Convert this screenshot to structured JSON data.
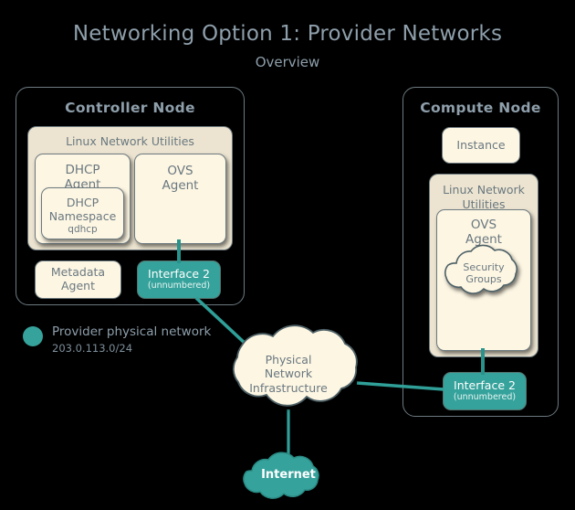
{
  "header": {
    "title": "Networking Option 1: Provider Networks",
    "subtitle": "Overview"
  },
  "colors": {
    "teal": "#35a29b",
    "cream_panel": "#ece4d0",
    "cream_box": "#fdf6e3",
    "border": "#6d7a80",
    "title_text": "#8e9fab",
    "body_text": "#6a7880",
    "background": "#000000"
  },
  "controller_node": {
    "title": "Controller Node",
    "linux_network_utilities": {
      "title": "Linux Network Utilities",
      "dhcp_agent": {
        "line1": "DHCP",
        "line2": "Agent",
        "namespace": {
          "line1": "DHCP",
          "line2": "Namespace",
          "line3": "qdhcp"
        }
      },
      "ovs_agent": {
        "line1": "OVS",
        "line2": "Agent"
      }
    },
    "metadata_agent": {
      "line1": "Metadata",
      "line2": "Agent"
    },
    "interface": {
      "name": "Interface 2",
      "detail": "(unnumbered)"
    }
  },
  "compute_node": {
    "title": "Compute Node",
    "instance": {
      "label": "Instance"
    },
    "linux_network_utilities": {
      "line1": "Linux Network",
      "line2": "Utilities",
      "ovs_agent": {
        "line1": "OVS",
        "line2": "Agent",
        "security_groups": {
          "line1": "Security",
          "line2": "Groups"
        }
      }
    },
    "interface": {
      "name": "Interface 2",
      "detail": "(unnumbered)"
    }
  },
  "legend": {
    "label": "Provider physical network",
    "cidr": "203.0.113.0/24"
  },
  "physical_network": {
    "line1": "Physical",
    "line2": "Network",
    "line3": "Infrastructure"
  },
  "internet": {
    "label": "Internet"
  }
}
